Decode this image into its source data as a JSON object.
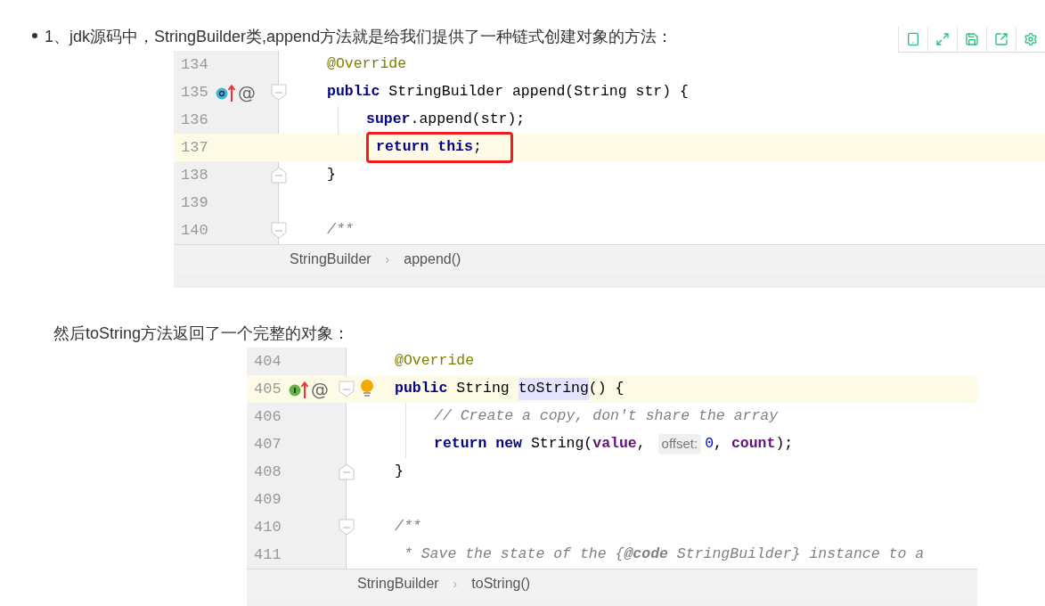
{
  "intro": "1、jdk源码中，StringBuilder类,append方法就是给我们提供了一种链式创建对象的方法：",
  "caption": "然后toString方法返回了一个完整的对象：",
  "snippets": [
    {
      "lines": [
        {
          "number": "134",
          "highlighted": false,
          "tokens": [
            {
              "kind": "annotation",
              "text": "@Override"
            }
          ]
        },
        {
          "number": "135",
          "highlighted": false,
          "marker": {
            "kind": "overrides",
            "symbol": "@"
          },
          "fold_start": true,
          "tokens": [
            {
              "kind": "keyword",
              "text": "public"
            },
            {
              "kind": "plain",
              "text": " StringBuilder append(String str) {"
            }
          ],
          "children": [
            {
              "number": "136",
              "highlighted": false,
              "tokens": [
                {
                  "kind": "keyword",
                  "text": "super"
                },
                {
                  "kind": "plain",
                  "text": ".append(str);"
                }
              ]
            },
            {
              "number": "137",
              "highlighted": true,
              "tokens": [
                {
                  "kind": "keyword",
                  "text": "return this",
                  "boxed": true
                },
                {
                  "kind": "plain",
                  "text": ";",
                  "boxed": true
                }
              ]
            }
          ]
        },
        {
          "number": "138",
          "highlighted": false,
          "fold_end": true,
          "tokens": [
            {
              "kind": "plain",
              "text": "}"
            }
          ]
        },
        {
          "number": "139",
          "highlighted": false
        },
        {
          "number": "140",
          "highlighted": false,
          "fold_start": true,
          "tokens": [
            {
              "kind": "comment",
              "text": "/**"
            }
          ]
        }
      ],
      "breadcrumbs": [
        "StringBuilder",
        "append()"
      ],
      "separator": "›"
    },
    {
      "lines": [
        {
          "number": "404",
          "highlighted": false,
          "tokens": [
            {
              "kind": "annotation",
              "text": "@Override"
            }
          ]
        },
        {
          "number": "405",
          "highlighted": true,
          "marker": {
            "kind": "implements",
            "symbol": "@"
          },
          "fold_start": true,
          "intention": true,
          "tokens": [
            {
              "kind": "keyword",
              "text": "public"
            },
            {
              "kind": "plain",
              "text": " String "
            },
            {
              "kind": "usage",
              "text": "toString"
            },
            {
              "kind": "plain",
              "text": "() {"
            }
          ],
          "children": [
            {
              "number": "406",
              "highlighted": false,
              "tokens": [
                {
                  "kind": "comment",
                  "text": "// Create a copy, don't share the array"
                }
              ]
            },
            {
              "number": "407",
              "highlighted": false,
              "tokens": [
                {
                  "kind": "keyword",
                  "text": "return new"
                },
                {
                  "kind": "plain",
                  "text": " String("
                },
                {
                  "kind": "field",
                  "text": "value"
                },
                {
                  "kind": "plain",
                  "text": ", "
                },
                {
                  "kind": "hint",
                  "text": "offset:"
                },
                {
                  "kind": "number",
                  "text": "0"
                },
                {
                  "kind": "plain",
                  "text": ", "
                },
                {
                  "kind": "field",
                  "text": "count"
                },
                {
                  "kind": "plain",
                  "text": ");"
                }
              ]
            }
          ]
        },
        {
          "number": "408",
          "highlighted": false,
          "fold_end": true,
          "tokens": [
            {
              "kind": "plain",
              "text": "}"
            }
          ]
        },
        {
          "number": "409",
          "highlighted": false
        },
        {
          "number": "410",
          "highlighted": false,
          "fold_start": true,
          "tokens": [
            {
              "kind": "comment",
              "text": "/**"
            }
          ]
        },
        {
          "number": "411",
          "highlighted": false,
          "tokens": [
            {
              "kind": "doc",
              "text": "* Save the state of the {"
            },
            {
              "kind": "doctag",
              "text": "@code"
            },
            {
              "kind": "comment",
              "text": " StringBuilder} instance to a"
            }
          ]
        }
      ],
      "breadcrumbs": [
        "StringBuilder",
        "toString()"
      ],
      "separator": "›"
    }
  ]
}
